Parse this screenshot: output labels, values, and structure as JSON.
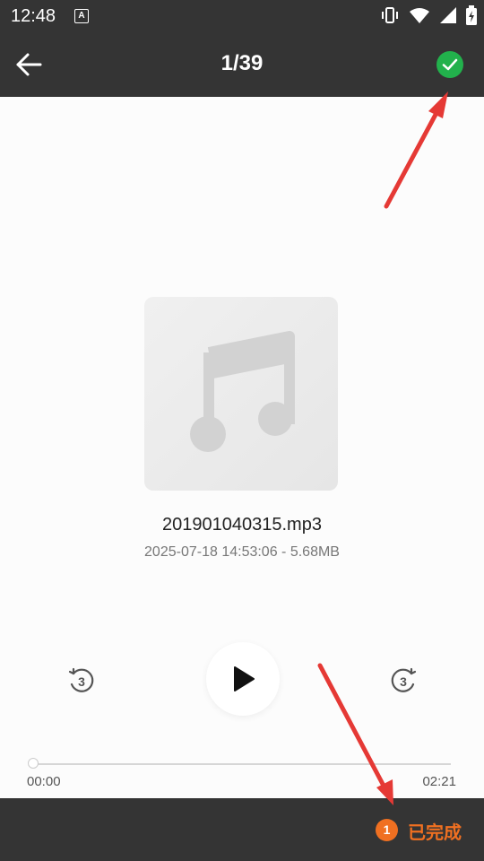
{
  "status_bar": {
    "time": "12:48",
    "notification_letter": "A",
    "icons": [
      "vibrate-icon",
      "wifi-icon",
      "signal-icon",
      "battery-icon"
    ]
  },
  "app_bar": {
    "title": "1/39",
    "back_icon": "arrow-left-icon",
    "confirm_icon": "check-circle-icon",
    "confirm_color": "#22b14c"
  },
  "file": {
    "name": "201901040315.mp3",
    "meta": "2025-07-18 14:53:06 - 5.68MB",
    "art_icon": "music-note-icon"
  },
  "player": {
    "rewind_icon": "rewind-3-icon",
    "play_icon": "play-icon",
    "forward_icon": "forward-3-icon",
    "rewind_label": "3",
    "forward_label": "3",
    "current_time": "00:00",
    "total_time": "02:21",
    "progress": 0
  },
  "bottom_bar": {
    "count": "1",
    "label": "已完成",
    "accent": "#f07021"
  },
  "annotations": {
    "arrow_color": "#e53935"
  }
}
